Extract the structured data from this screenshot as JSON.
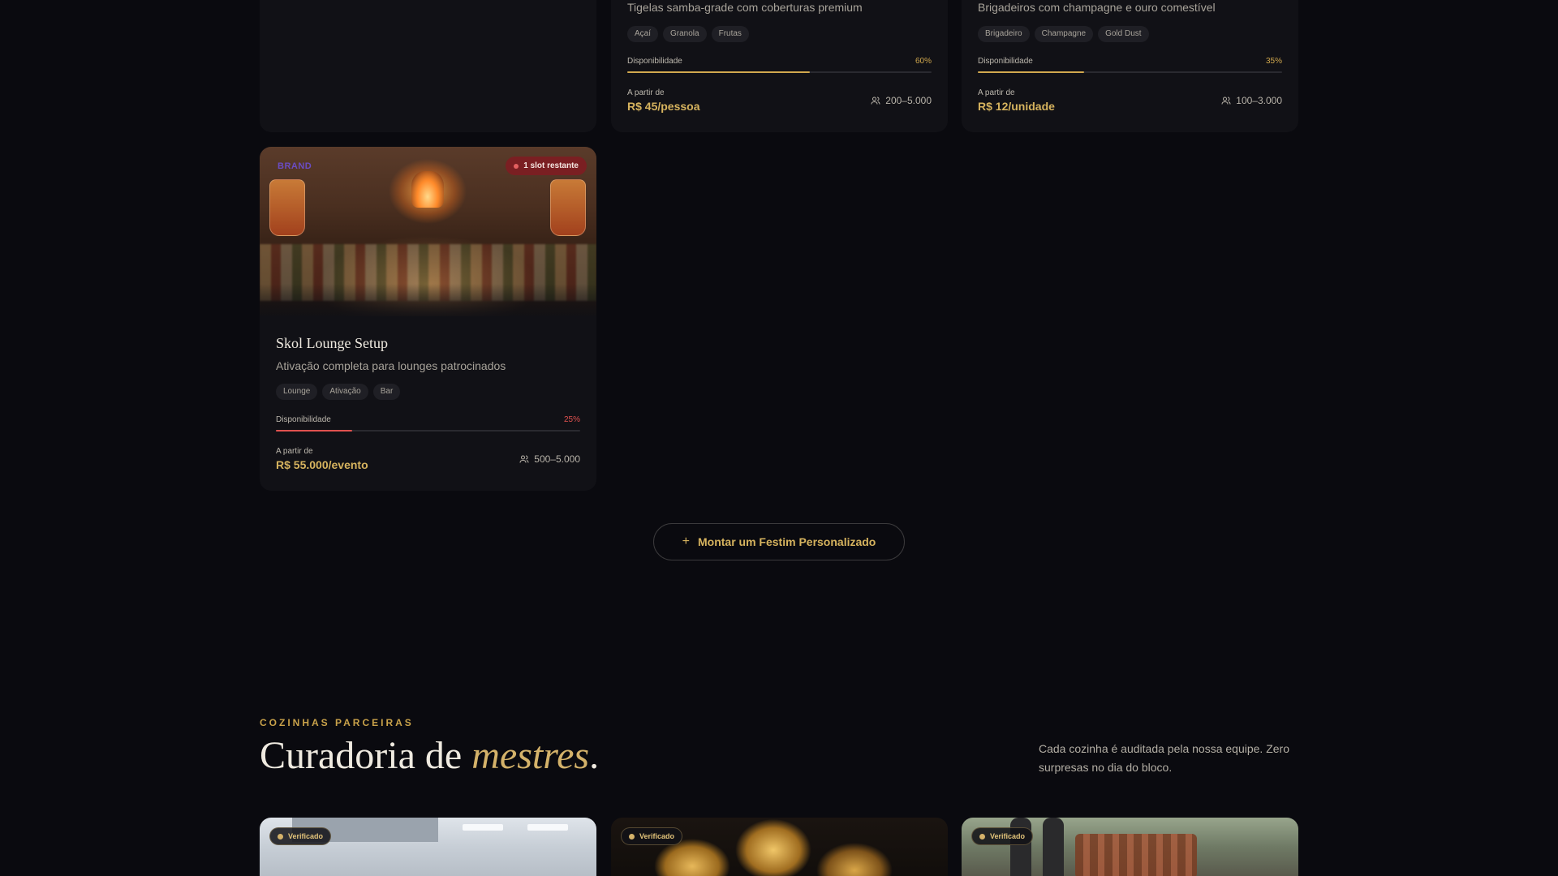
{
  "cards": [
    {
      "description": "Tigelas samba-grade com coberturas premium",
      "tags": [
        "Açaí",
        "Granola",
        "Frutas"
      ],
      "availability_label": "Disponibilidade",
      "availability_pct": "60%",
      "availability_value": 0.6,
      "price_from": "A partir de",
      "price": "R$ 45/pessoa",
      "capacity": "200–5.000"
    },
    {
      "description": "Brigadeiros com champagne e ouro comestível",
      "tags": [
        "Brigadeiro",
        "Champagne",
        "Gold Dust"
      ],
      "availability_label": "Disponibilidade",
      "availability_pct": "35%",
      "availability_value": 0.35,
      "price_from": "A partir de",
      "price": "R$ 12/unidade",
      "capacity": "100–3.000"
    },
    {
      "title": "Skol Lounge Setup",
      "description": "Ativação completa para lounges patrocinados",
      "tags": [
        "Lounge",
        "Ativação",
        "Bar"
      ],
      "badge": "1 slot restante",
      "brand_mark": "BRAND",
      "availability_label": "Disponibilidade",
      "availability_pct": "25%",
      "availability_value": 0.25,
      "price_from": "A partir de",
      "price": "R$ 55.000/evento",
      "capacity": "500–5.000"
    }
  ],
  "custom_button": {
    "icon": "plus-icon",
    "label": "Montar um Festim Personalizado"
  },
  "section": {
    "eyebrow": "COZINHAS PARCEIRAS",
    "title_main": "Curadoria de ",
    "title_accent": "mestres",
    "title_end": ".",
    "note": "Cada cozinha é auditada pela nossa equipe. Zero surpresas no dia do bloco."
  },
  "kitchens": [
    {
      "badge": "Verificado"
    },
    {
      "badge": "Verificado"
    },
    {
      "badge": "Verificado"
    }
  ],
  "colors": {
    "background": "#0a0a0f",
    "card": "#111116",
    "gold": "#d1a84e",
    "danger": "#e0514f"
  }
}
